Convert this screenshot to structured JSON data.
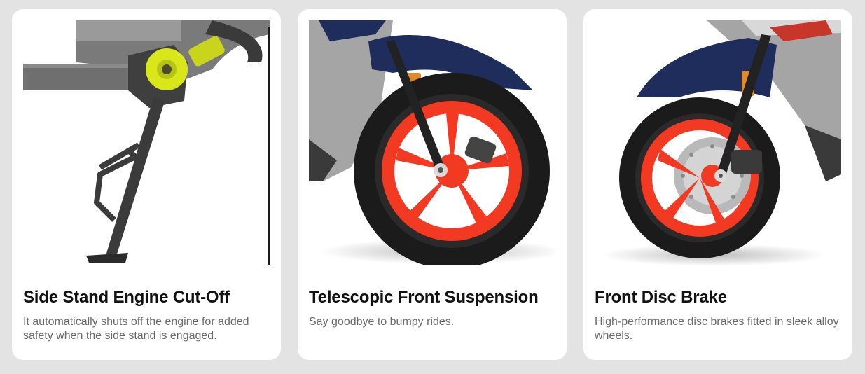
{
  "cards": [
    {
      "title": "Side Stand Engine Cut-Off",
      "description": "It automatically shuts off the engine for added safety when the side stand is engaged.",
      "image": "side-stand-image"
    },
    {
      "title": "Telescopic Front Suspension",
      "description": "Say goodbye to bumpy rides.",
      "image": "telescopic-suspension-image"
    },
    {
      "title": "Front Disc Brake",
      "description": "High-performance disc brakes fitted in sleek alloy wheels.",
      "image": "disc-brake-image"
    }
  ],
  "colors": {
    "page_background": "#e3e3e3",
    "card_background": "#ffffff",
    "rim_red": "#f23a22",
    "body_navy": "#1f2d5c",
    "sensor_yellow": "#d8e61a"
  }
}
